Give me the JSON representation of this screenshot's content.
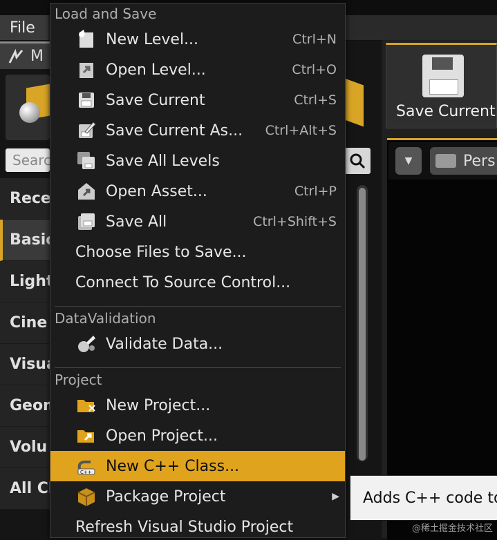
{
  "menubar": {
    "file_label": "File"
  },
  "modes": {
    "tab_label": "M"
  },
  "place_panel": {
    "search_placeholder": "Search",
    "categories": [
      "Rece",
      "Basic",
      "Light",
      "Cine",
      "Visua",
      "Geom",
      "Volu",
      "All Cl"
    ],
    "active_category_index": 1
  },
  "toolbar": {
    "save_current_label": "Save Current"
  },
  "viewport": {
    "perspective_label": "Pers"
  },
  "menu": {
    "sections": {
      "load_save": "Load and Save",
      "data_validation": "DataValidation",
      "project": "Project"
    },
    "load_save_items": [
      {
        "label": "New Level...",
        "shortcut": "Ctrl+N",
        "icon": "new-level-icon"
      },
      {
        "label": "Open Level...",
        "shortcut": "Ctrl+O",
        "icon": "open-level-icon"
      },
      {
        "label": "Save Current",
        "shortcut": "Ctrl+S",
        "icon": "save-icon"
      },
      {
        "label": "Save Current As...",
        "shortcut": "Ctrl+Alt+S",
        "icon": "save-as-icon"
      },
      {
        "label": "Save All Levels",
        "shortcut": "",
        "icon": "save-all-levels-icon"
      },
      {
        "label": "Open Asset...",
        "shortcut": "Ctrl+P",
        "icon": "open-asset-icon"
      },
      {
        "label": "Save All",
        "shortcut": "Ctrl+Shift+S",
        "icon": "save-all-icon"
      }
    ],
    "choose_files_label": "Choose Files to Save...",
    "source_control_label": "Connect To Source Control...",
    "validate_label": "Validate Data...",
    "new_project_label": "New Project...",
    "open_project_label": "Open Project...",
    "new_cpp_label": "New C++ Class...",
    "package_label": "Package Project",
    "refresh_vs_label": "Refresh Visual Studio Project"
  },
  "tooltip": {
    "text": "Adds C++ code to"
  },
  "watermark": "@稀土掘金技术社区",
  "colors": {
    "accent": "#e0a31d",
    "menu_bg": "#1c1c1c"
  }
}
